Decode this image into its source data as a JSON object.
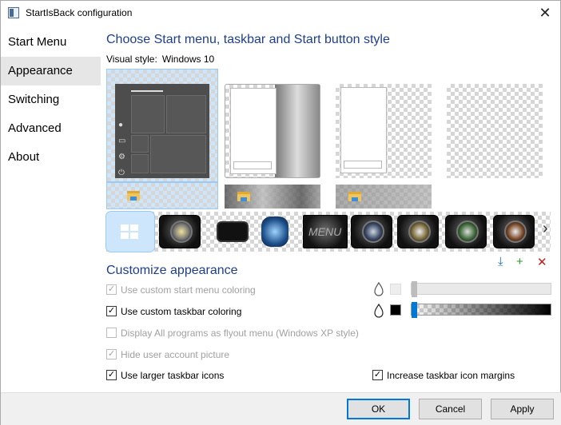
{
  "window": {
    "title": "StartIsBack configuration"
  },
  "sidebar": {
    "items": [
      {
        "label": "Start Menu"
      },
      {
        "label": "Appearance"
      },
      {
        "label": "Switching"
      },
      {
        "label": "Advanced"
      },
      {
        "label": "About"
      }
    ],
    "selected": "Appearance"
  },
  "style_section": {
    "title": "Choose Start menu, taskbar and Start button style",
    "visual_style_label": "Visual style:",
    "visual_style_value": "Windows 10"
  },
  "customize": {
    "title": "Customize appearance",
    "options": [
      {
        "label": "Use custom start menu coloring",
        "checked": true,
        "enabled": false
      },
      {
        "label": "Use custom taskbar coloring",
        "checked": true,
        "enabled": true
      },
      {
        "label": "Display All programs as flyout menu (Windows XP style)",
        "checked": false,
        "enabled": false
      },
      {
        "label": "Hide user account picture",
        "checked": true,
        "enabled": false
      },
      {
        "label": "Use larger taskbar icons",
        "checked": true,
        "enabled": true
      },
      {
        "label": "Increase taskbar icon margins",
        "checked": true,
        "enabled": true
      }
    ],
    "start_menu_color": "#eeeeee",
    "taskbar_color": "#000000",
    "start_menu_transparency": 0.0,
    "taskbar_transparency": 0.0
  },
  "toolbar_icons": {
    "download": "download-icon",
    "add": "plus-icon",
    "remove": "x-icon"
  },
  "buttons": {
    "ok": "OK",
    "cancel": "Cancel",
    "apply": "Apply"
  },
  "colors": {
    "accent": "#0078d7",
    "heading": "#1e3e8c",
    "selection": "#cde6fb"
  }
}
